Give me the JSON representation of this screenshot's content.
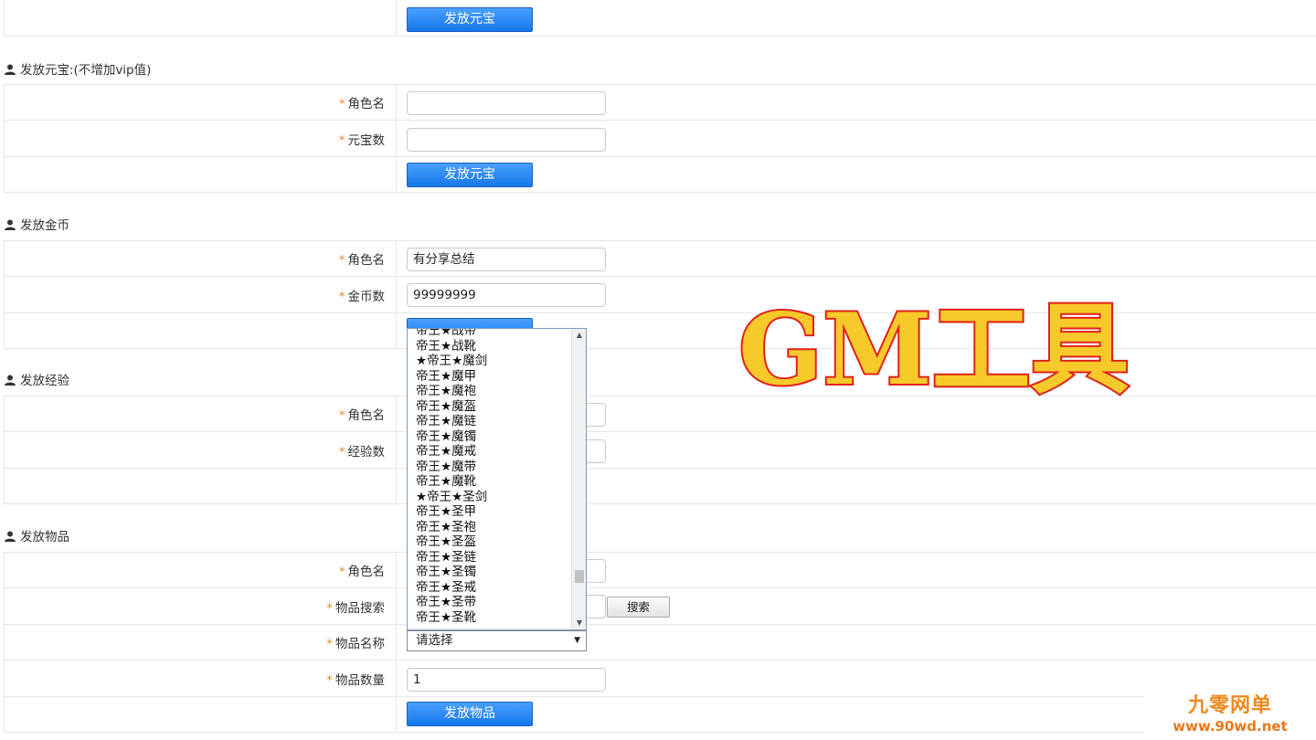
{
  "sections": {
    "yuanbao": {
      "title": "发放元宝:(不增加vip值)"
    },
    "gold": {
      "title": "发放金币"
    },
    "exp": {
      "title": "发放经验"
    },
    "item": {
      "title": "发放物品"
    }
  },
  "top_button": "发放元宝",
  "yuanbao_form": {
    "role_label": "角色名",
    "amount_label": "元宝数",
    "submit": "发放元宝"
  },
  "gold_form": {
    "role_label": "角色名",
    "role_value": "有分享总结",
    "amount_label": "金币数",
    "amount_value": "99999999"
  },
  "exp_form": {
    "role_label": "角色名",
    "amount_label": "经验数"
  },
  "item_form": {
    "role_label": "角色名",
    "search_label": "物品搜索",
    "search_button": "搜索",
    "name_label": "物品名称",
    "name_selected": "请选择",
    "qty_label": "物品数量",
    "qty_value": "1",
    "submit": "发放物品"
  },
  "required_mark": "*",
  "dropdown_options": [
    "帝王★战带",
    "帝王★战靴",
    "★帝王★魔剑",
    "帝王★魔甲",
    "帝王★魔袍",
    "帝王★魔盔",
    "帝王★魔链",
    "帝王★魔镯",
    "帝王★魔戒",
    "帝王★魔带",
    "帝王★魔靴",
    "★帝王★圣剑",
    "帝王★圣甲",
    "帝王★圣袍",
    "帝王★圣盔",
    "帝王★圣链",
    "帝王★圣镯",
    "帝王★圣戒",
    "帝王★圣带",
    "帝王★圣靴"
  ],
  "watermark_text": "GM工具",
  "brand": {
    "name": "九零网单",
    "url": "www.90wd.net"
  },
  "colors": {
    "button_blue": "#1577ea",
    "required_orange": "#e8892e",
    "watermark_fill": "#f7c92a",
    "watermark_stroke": "#e0211a"
  },
  "icons": {
    "section": "user-icon",
    "select": "caret-down-icon",
    "scroll_up": "caret-up-icon"
  }
}
